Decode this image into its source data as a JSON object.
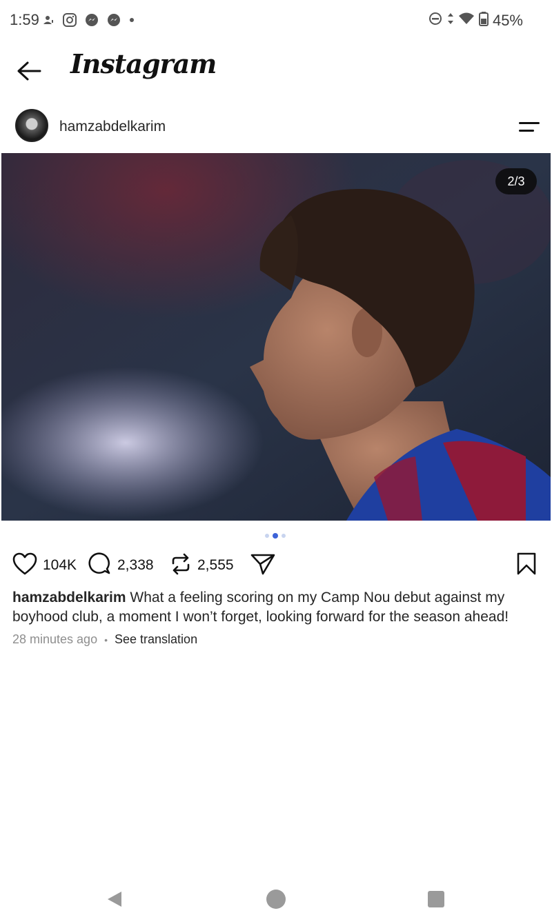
{
  "status_bar": {
    "time": "1:59",
    "battery": "45%",
    "icons": [
      "account-alert-icon",
      "instagram-icon",
      "messenger-icon",
      "messenger-icon",
      "dot-icon",
      "do-not-disturb-icon",
      "data-arrows-icon",
      "wifi-icon",
      "battery-icon"
    ]
  },
  "header": {
    "title": "Instagram",
    "back_icon": "back-arrow-icon"
  },
  "post": {
    "username": "hamzabdelkarim",
    "image_counter": "2/3",
    "carousel": {
      "count": 3,
      "active_index": 1
    },
    "likes": "104K",
    "comments": "2,338",
    "reposts": "2,555",
    "caption_user": "hamzabdelkarim",
    "caption_text": "What a feeling scoring on my Camp Nou debut against my boyhood club, a moment I won’t forget, looking forward for the season ahead!",
    "time_ago": "28 minutes ago",
    "separator": "•",
    "translate_label": "See translation"
  },
  "colors": {
    "accent_dot": "#3d63d8",
    "muted_text": "#8e8e8e",
    "jersey_blue": "#1f3fa0",
    "jersey_red": "#8e1a3a"
  }
}
